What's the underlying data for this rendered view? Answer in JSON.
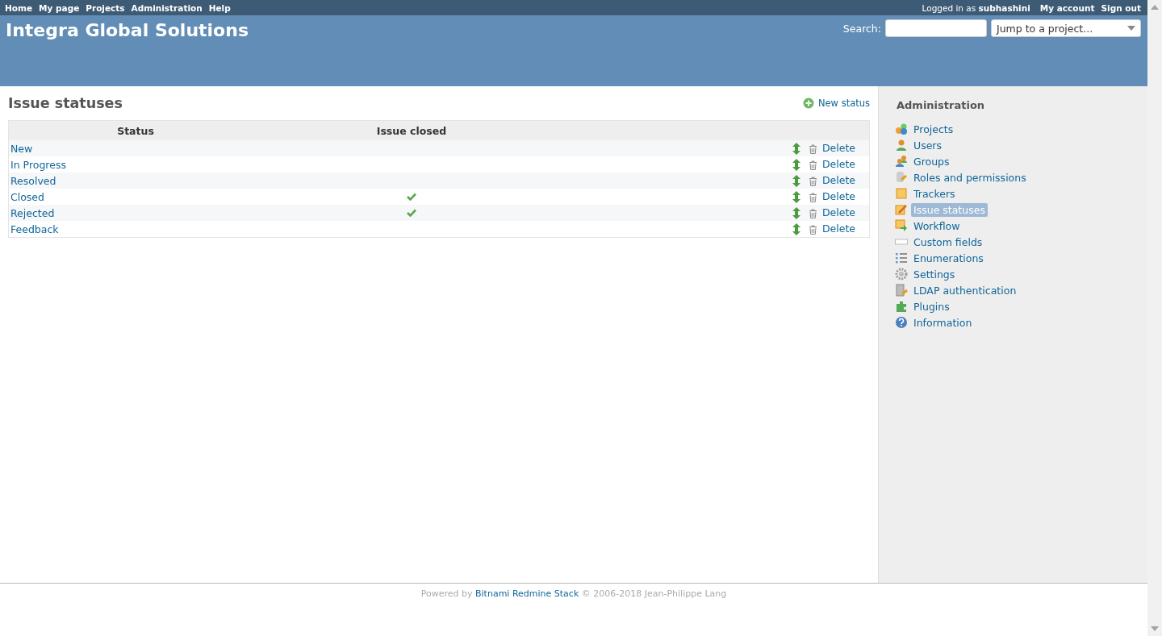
{
  "top_menu": {
    "left": [
      "Home",
      "My page",
      "Projects",
      "Administration",
      "Help"
    ],
    "logged_in_prefix": "Logged in as",
    "user": "subhashini",
    "right": [
      "My account",
      "Sign out"
    ]
  },
  "header": {
    "title": "Integra Global Solutions",
    "search_label": "Search:",
    "project_jump": "Jump to a project..."
  },
  "content": {
    "title": "Issue statuses",
    "new_link": "New status",
    "columns": [
      "Status",
      "Issue closed"
    ],
    "rows": [
      {
        "name": "New",
        "closed": false,
        "delete": "Delete"
      },
      {
        "name": "In Progress",
        "closed": false,
        "delete": "Delete"
      },
      {
        "name": "Resolved",
        "closed": false,
        "delete": "Delete"
      },
      {
        "name": "Closed",
        "closed": true,
        "delete": "Delete"
      },
      {
        "name": "Rejected",
        "closed": true,
        "delete": "Delete"
      },
      {
        "name": "Feedback",
        "closed": false,
        "delete": "Delete"
      }
    ]
  },
  "sidebar": {
    "title": "Administration",
    "items": [
      {
        "label": "Projects",
        "selected": false
      },
      {
        "label": "Users",
        "selected": false
      },
      {
        "label": "Groups",
        "selected": false
      },
      {
        "label": "Roles and permissions",
        "selected": false
      },
      {
        "label": "Trackers",
        "selected": false
      },
      {
        "label": "Issue statuses",
        "selected": true
      },
      {
        "label": "Workflow",
        "selected": false
      },
      {
        "label": "Custom fields",
        "selected": false
      },
      {
        "label": "Enumerations",
        "selected": false
      },
      {
        "label": "Settings",
        "selected": false
      },
      {
        "label": "LDAP authentication",
        "selected": false
      },
      {
        "label": "Plugins",
        "selected": false
      },
      {
        "label": "Information",
        "selected": false
      }
    ]
  },
  "footer": {
    "prefix": "Powered by",
    "link": "Bitnami Redmine Stack",
    "suffix": "© 2006-2018 Jean-Philippe Lang"
  }
}
